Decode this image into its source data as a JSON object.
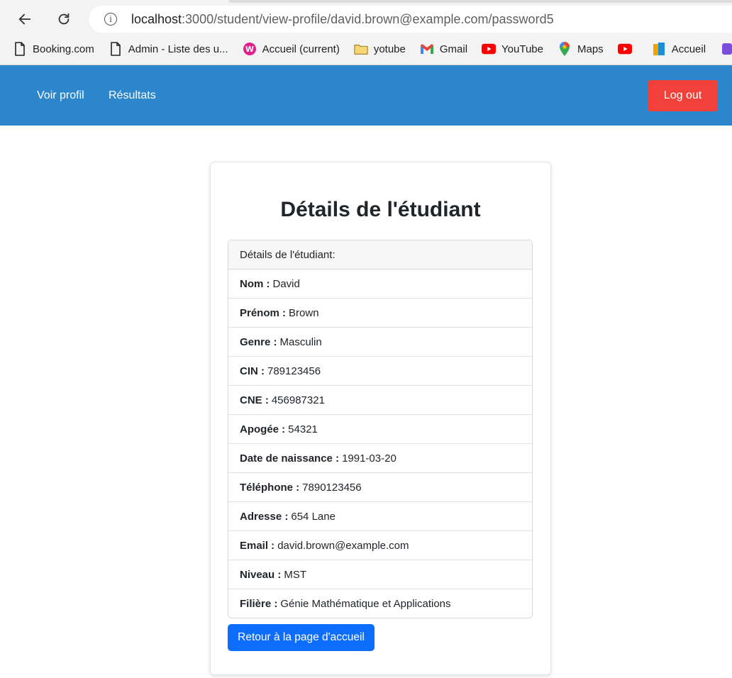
{
  "browser": {
    "url_host": "localhost",
    "url_path": ":3000/student/view-profile/david.brown@example.com/password5",
    "bookmarks": [
      {
        "label": "Booking.com",
        "icon": "page-icon"
      },
      {
        "label": "Admin - Liste des u...",
        "icon": "page-icon"
      },
      {
        "label": "Accueil (current)",
        "icon": "wamp-icon"
      },
      {
        "label": "yotube",
        "icon": "folder-icon"
      },
      {
        "label": "Gmail",
        "icon": "gmail-icon"
      },
      {
        "label": "YouTube",
        "icon": "youtube-icon"
      },
      {
        "label": "Maps",
        "icon": "maps-icon"
      },
      {
        "label": "",
        "icon": "youtube-icon"
      },
      {
        "label": "Accueil",
        "icon": "bookmark-app-icon"
      }
    ]
  },
  "navbar": {
    "links": [
      "Voir profil",
      "Résultats"
    ],
    "logout_label": "Log out",
    "color": "#2b86cc",
    "logout_color": "#f2403a"
  },
  "card": {
    "title": "Détails de l'étudiant",
    "list_header": "Détails de l'étudiant:",
    "fields": [
      {
        "label": "Nom :",
        "value": "David"
      },
      {
        "label": "Prénom :",
        "value": "Brown"
      },
      {
        "label": "Genre :",
        "value": "Masculin"
      },
      {
        "label": "CIN :",
        "value": "789123456"
      },
      {
        "label": "CNE :",
        "value": "456987321"
      },
      {
        "label": "Apogée :",
        "value": "54321"
      },
      {
        "label": "Date de naissance :",
        "value": "1991-03-20"
      },
      {
        "label": "Téléphone :",
        "value": "7890123456"
      },
      {
        "label": "Adresse :",
        "value": "654 Lane"
      },
      {
        "label": "Email :",
        "value": "david.brown@example.com"
      },
      {
        "label": "Niveau :",
        "value": "MST"
      },
      {
        "label": "Filière :",
        "value": "Génie Mathématique et Applications"
      }
    ],
    "back_button": "Retour à la page d'accueil",
    "back_button_color": "#0d6efd"
  }
}
